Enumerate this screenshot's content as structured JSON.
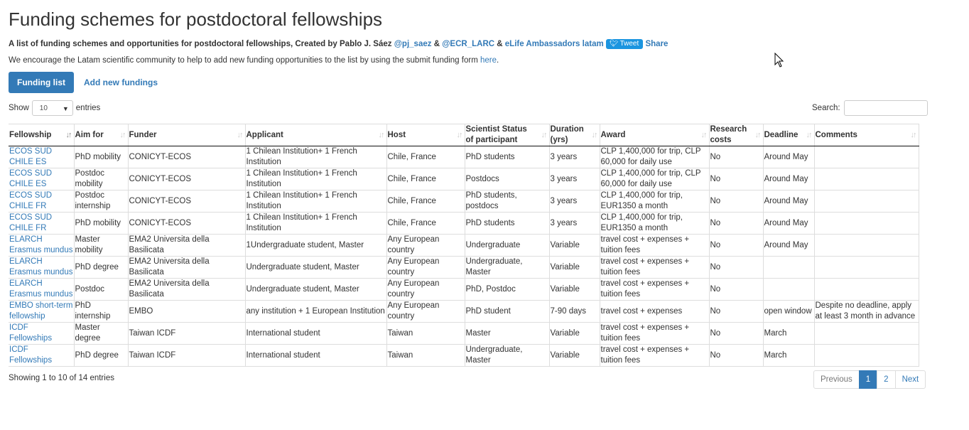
{
  "page": {
    "title": "Funding schemes for postdoctoral fellowships",
    "subtitle_prefix": "A list of funding schemes and opportunities for postdoctoral fellowships, Created by Pablo J. Sáez",
    "link_pj": "@pj_saez",
    "amp1": "&",
    "link_ecr": "@ECR_LARC",
    "amp2": "&",
    "link_elife": "eLife Ambassadors latam",
    "tweet_label": "Tweet",
    "share_label": "Share",
    "encourage_text": "We encourage the Latam scientific community to help to add new funding opportunities to the list by using the submit funding form",
    "encourage_link": "here",
    "encourage_end": "."
  },
  "tabs": {
    "funding_list": "Funding list",
    "add_new": "Add new fundings"
  },
  "controls": {
    "show_label": "Show",
    "entries_value": "10",
    "entries_label": "entries",
    "search_label": "Search:"
  },
  "table": {
    "columns": [
      "Fellowship",
      "Aim for",
      "Funder",
      "Applicant",
      "Host",
      "Scientist Status of participant",
      "Duration (yrs)",
      "Award",
      "Research costs",
      "Deadline",
      "Comments"
    ],
    "rows": [
      [
        "ECOS SUD CHILE ES",
        "PhD mobility",
        "CONICYT-ECOS",
        "1 Chilean Institution+ 1 French Institution",
        "Chile, France",
        "PhD students",
        "3 years",
        "CLP 1,400,000 for trip, CLP 60,000 for daily use",
        "No",
        "Around May",
        ""
      ],
      [
        "ECOS SUD CHILE ES",
        "Postdoc mobility",
        "CONICYT-ECOS",
        "1 Chilean Institution+ 1 French Institution",
        "Chile, France",
        "Postdocs",
        "3 years",
        "CLP 1,400,000 for trip, CLP 60,000 for daily use",
        "No",
        "Around May",
        ""
      ],
      [
        "ECOS SUD CHILE FR",
        "Postdoc internship",
        "CONICYT-ECOS",
        "1 Chilean Institution+ 1 French Institution",
        "Chile, France",
        "PhD students, postdocs",
        "3 years",
        "CLP 1,400,000 for trip, EUR1350 a month",
        "No",
        "Around May",
        ""
      ],
      [
        "ECOS SUD CHILE FR",
        "PhD mobility",
        "CONICYT-ECOS",
        "1 Chilean Institution+ 1 French Institution",
        "Chile, France",
        "PhD students",
        "3 years",
        "CLP 1,400,000 for trip, EUR1350 a month",
        "No",
        "Around May",
        ""
      ],
      [
        "ELARCH Erasmus mundus",
        "Master mobility",
        "EMA2 Universita della Basilicata",
        "1Undergraduate student, Master",
        "Any European country",
        "Undergraduate",
        "Variable",
        "travel cost + expenses + tuition fees",
        "No",
        "Around May",
        ""
      ],
      [
        "ELARCH Erasmus mundus",
        "PhD degree",
        "EMA2 Universita della Basilicata",
        "Undergraduate student, Master",
        "Any European country",
        "Undergraduate, Master",
        "Variable",
        "travel cost + expenses + tuition fees",
        "No",
        "",
        ""
      ],
      [
        "ELARCH Erasmus mundus",
        "Postdoc",
        "EMA2 Universita della Basilicata",
        "Undergraduate student, Master",
        "Any European country",
        "PhD, Postdoc",
        "Variable",
        "travel cost + expenses + tuition fees",
        "No",
        "",
        ""
      ],
      [
        "EMBO short-term fellowship",
        "PhD internship",
        "EMBO",
        "any institution + 1 European Institution",
        "Any European country",
        "PhD student",
        "7-90 days",
        "travel cost + expenses",
        "No",
        "open window",
        "Despite no deadline, apply at least 3 month in advance"
      ],
      [
        "ICDF Fellowships",
        "Master degree",
        "Taiwan ICDF",
        "International student",
        "Taiwan",
        "Master",
        "Variable",
        "travel cost + expenses + tuition fees",
        "No",
        "March",
        ""
      ],
      [
        "ICDF Fellowships",
        "PhD degree",
        "Taiwan ICDF",
        "International student",
        "Taiwan",
        "Undergraduate, Master",
        "Variable",
        "travel cost + expenses + tuition fees",
        "No",
        "March",
        ""
      ]
    ]
  },
  "footer": {
    "info": "Showing 1 to 10 of 14 entries",
    "previous": "Previous",
    "page1": "1",
    "page2": "2",
    "next": "Next"
  },
  "colors": {
    "primary": "#337ab7",
    "tweet": "#1b95e0",
    "text": "#333333"
  }
}
